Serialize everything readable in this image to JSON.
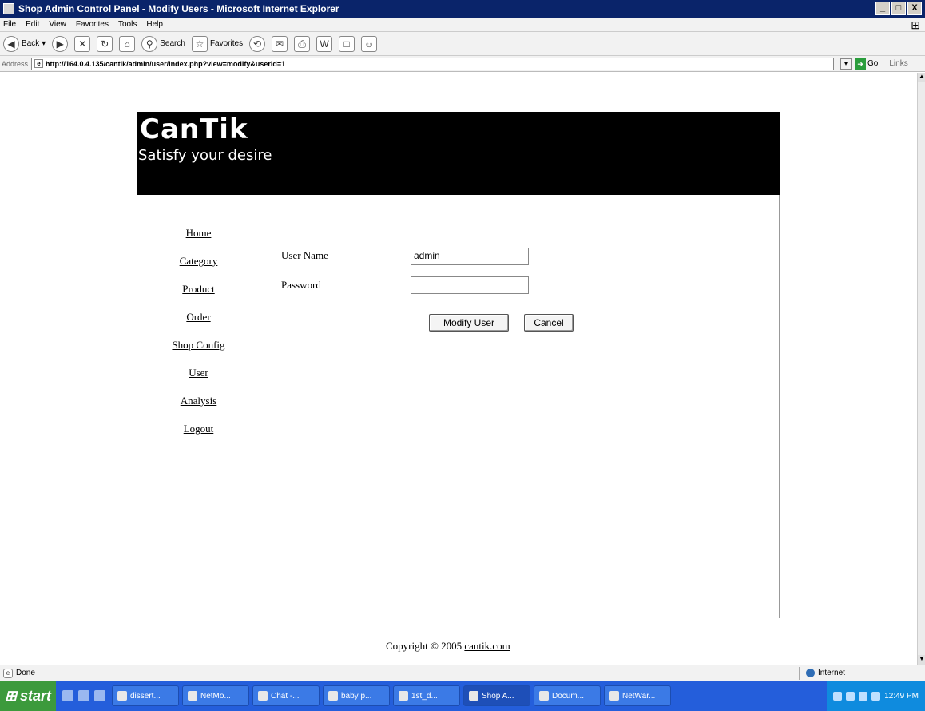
{
  "window": {
    "title": "Shop Admin Control Panel - Modify Users - Microsoft Internet Explorer",
    "controls": [
      "_",
      "□",
      "X"
    ]
  },
  "menubar": [
    "File",
    "Edit",
    "View",
    "Favorites",
    "Tools",
    "Help"
  ],
  "toolbar": {
    "back": "Back",
    "search": "Search",
    "favorites": "Favorites"
  },
  "addressbar": {
    "label": "Address",
    "url": "http://164.0.4.135/cantik/admin/user/index.php?view=modify&userId=1",
    "go": "Go",
    "links": "Links"
  },
  "site": {
    "logo": "CanTik",
    "tagline": "Satisfy your desire",
    "nav": [
      "Home",
      "Category",
      "Product",
      "Order",
      "Shop Config",
      "User",
      "Analysis",
      "Logout"
    ],
    "form": {
      "username_label": "User Name",
      "username_value": "admin",
      "password_label": "Password",
      "password_value": "",
      "modify_button": "Modify User",
      "cancel_button": "Cancel"
    },
    "copyright_prefix": "Copyright © 2005",
    "copyright_link": "cantik.com"
  },
  "status": {
    "text": "Done",
    "zone": "Internet"
  },
  "taskbar": {
    "start": "start",
    "tasks": [
      "dissert...",
      "NetMo...",
      "Chat -...",
      "baby p...",
      "1st_d...",
      "Shop A...",
      "Docum...",
      "NetWar..."
    ],
    "clock": "12:49 PM"
  }
}
